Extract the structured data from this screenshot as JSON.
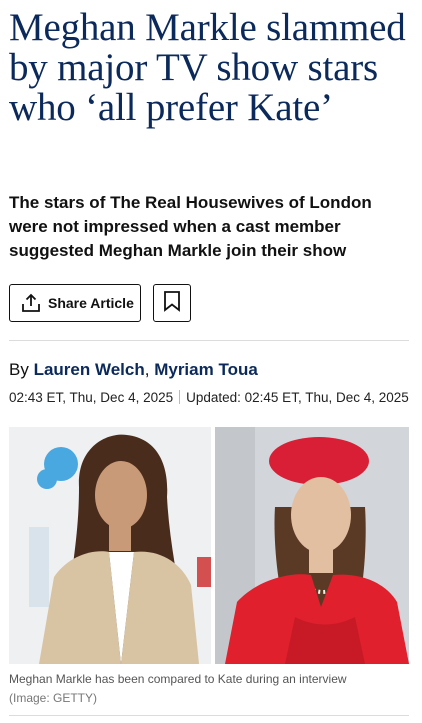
{
  "article": {
    "headline": "Meghan Markle slammed by major TV show stars who ‘all prefer Kate’",
    "standfirst": "The stars of The Real Housewives of London were not impressed when a cast member suggested Meghan Markle join their show",
    "share_label": "Share Article",
    "byline": {
      "prefix": "By",
      "authors": [
        "Lauren Welch",
        "Myriam Toua"
      ],
      "separator": ","
    },
    "published": "02:43 ET, Thu, Dec 4, 2025",
    "updated": "Updated: 02:45 ET, Thu, Dec 4, 2025"
  },
  "image": {
    "caption": "Meghan Markle has been compared to Kate during an interview",
    "credit": "(Image: GETTY)"
  },
  "icons": {
    "share": "share-icon",
    "bookmark": "bookmark-icon"
  },
  "colors": {
    "headline": "#0b2a5b",
    "author_link": "#0b2a5b",
    "text": "#111111",
    "caption": "#555555"
  }
}
